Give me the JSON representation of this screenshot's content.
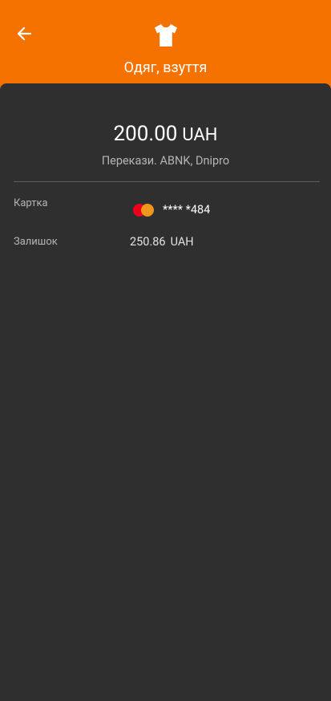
{
  "header": {
    "title": "Одяг, взуття",
    "back_icon": "arrow-back-icon",
    "category_icon": "tshirt-icon",
    "background_color": "#F57200"
  },
  "transaction": {
    "amount": "200.00",
    "currency": "UAH",
    "merchant": "Перекази. ABNK, Dnipro"
  },
  "details": {
    "card_label": "Картка",
    "card_icon": "mastercard-logo-icon",
    "card_number": "**** *484",
    "balance_label": "Залишок",
    "balance_value": "250.86",
    "balance_currency": "UAH"
  },
  "colors": {
    "sheet_background": "#2f2f2f",
    "accent": "#F57200",
    "secondary_text": "#b5b5b5"
  }
}
